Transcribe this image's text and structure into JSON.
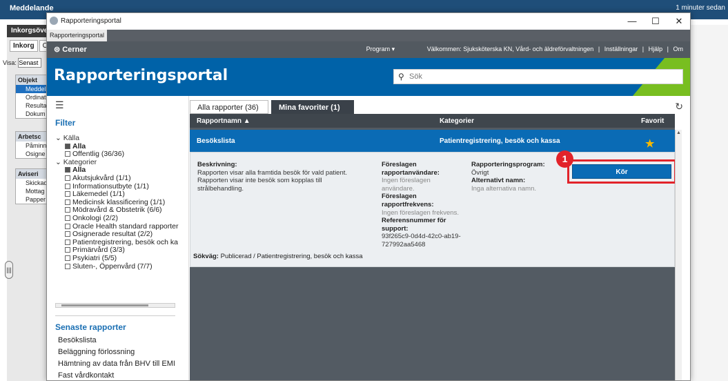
{
  "background": {
    "top_title": "Meddelande",
    "top_right": "1 minuter sedan",
    "sub_title": "Inkorgsöver",
    "tabs": [
      "Inkorg",
      "Om"
    ],
    "visa_label": "Visa:",
    "visa_value": "Senast",
    "box1_header": "Objekt",
    "box1_items": [
      "Meddel",
      "Ordinat",
      "Resultat",
      "Dokum"
    ],
    "box2_header": "Arbetsc",
    "box2_items": [
      "Påminn",
      "Osigne"
    ],
    "box3_header": "Aviseri",
    "box3_items": [
      "Skickad",
      "Mottag",
      "Papper"
    ]
  },
  "window": {
    "title": "Rapporteringsportal",
    "minimize": "—",
    "maximize": "☐",
    "close": "✕",
    "tab_label": "Rapporteringsportal"
  },
  "cerner": {
    "logo": "Cerner",
    "program": "Program ▾",
    "welcome": "Välkommen: Sjuksköterska KN, Vård- och äldreförvaltningen",
    "settings": "Inställningar",
    "help": "Hjälp",
    "about": "Om",
    "sep": "|"
  },
  "banner": {
    "title": "Rapporteringsportal",
    "search_placeholder": "Sök"
  },
  "sidebar": {
    "filter_title": "Filter",
    "source_group": "Källa",
    "source_all": "Alla",
    "source_items": [
      "Offentlig (36/36)"
    ],
    "category_group": "Kategorier",
    "category_all": "Alla",
    "category_items": [
      "Akutsjukvård (1/1)",
      "Informationsutbyte (1/1)",
      "Läkemedel (1/1)",
      "Medicinsk klassificering (1/1)",
      "Mödravård & Obstetrik (6/6)",
      "Onkologi (2/2)",
      "Oracle Health standard rapporter",
      "Osignerade resultat (2/2)",
      "Patientregistrering, besök och ka",
      "Primärvård (3/3)",
      "Psykiatri (5/5)",
      "Sluten-, Öppenvård (7/7)"
    ],
    "recent_title": "Senaste rapporter",
    "recent_items": [
      "Besökslista",
      "Beläggning förlossning",
      "Hämtning av data från BHV till EMI",
      "Fast vårdkontakt"
    ]
  },
  "main": {
    "tab_all": "Alla rapporter (36)",
    "tab_fav": "Mina favoriter (1)",
    "col_name": "Rapportnamn ▲",
    "col_category": "Kategorier",
    "col_favorite": "Favorit",
    "row": {
      "name": "Besökslista",
      "category": "Patientregistrering, besök och kassa"
    },
    "detail": {
      "desc_label": "Beskrivning:",
      "desc_lines": [
        "Rapporten visar alla framtida besök för vald patient.",
        "Rapporten visar inte besök som kopplas till",
        "strålbehandling."
      ],
      "users_label_1": "Föreslagen",
      "users_label_2": "rapportanvändare:",
      "users_value_1": "Ingen föreslagen",
      "users_value_2": "användare.",
      "freq_label_1": "Föreslagen",
      "freq_label_2": "rapportfrekvens:",
      "freq_value": "Ingen föreslagen frekvens.",
      "ref_label_1": "Referensnummer för",
      "ref_label_2": "support:",
      "ref_value_1": "93f265c9-0d4d-42c0-ab19-",
      "ref_value_2": "727992aa5468",
      "prog_label": "Rapporteringsprogram:",
      "prog_value": "Övrigt",
      "alt_label": "Alternativt namn:",
      "alt_value": "Inga alternativa namn.",
      "run_button": "Kör",
      "badge": "1",
      "path_label": "Sökväg:",
      "path_value": "Publicerad / Patientregistrering, besök och kassa"
    }
  }
}
